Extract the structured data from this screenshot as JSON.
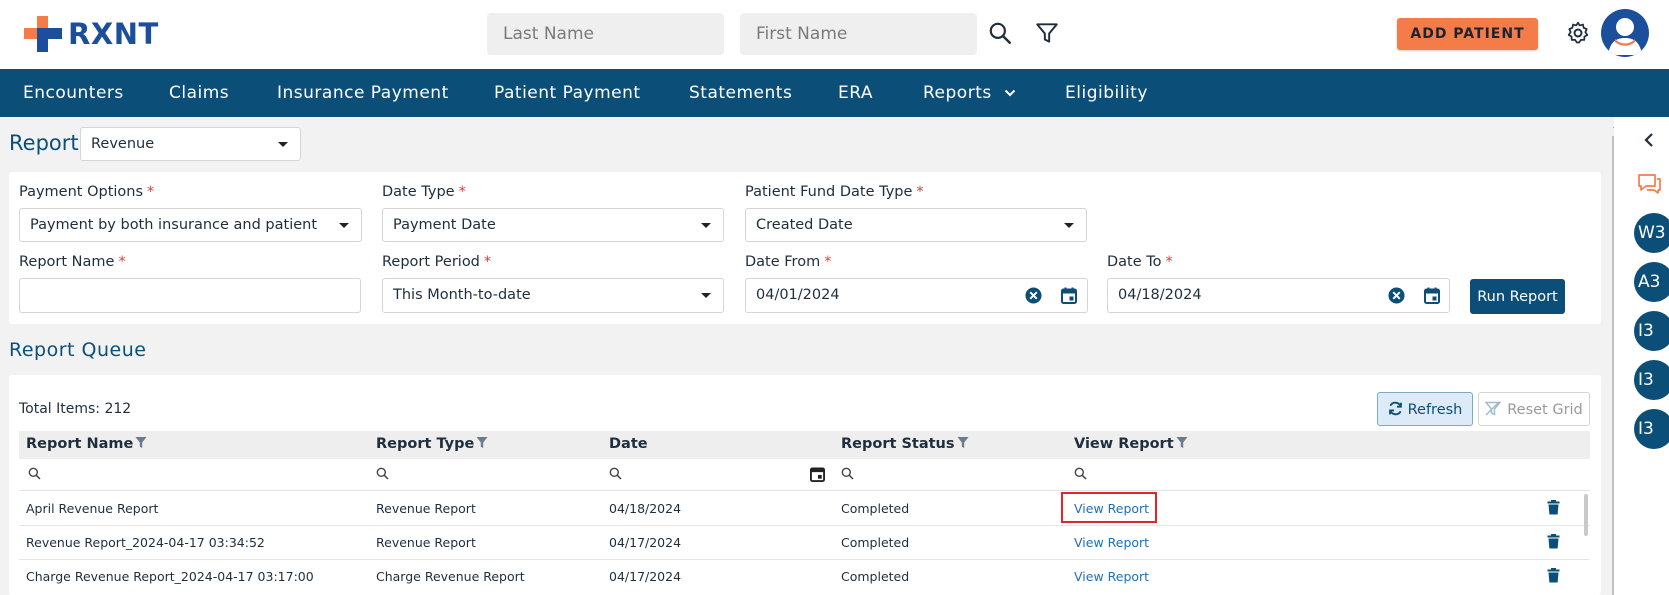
{
  "header": {
    "logo_text": "RXNT",
    "last_name_placeholder": "Last Name",
    "first_name_placeholder": "First Name",
    "add_patient_label": "ADD PATIENT"
  },
  "nav": {
    "items": [
      "Encounters",
      "Claims",
      "Insurance Payment",
      "Patient Payment",
      "Statements",
      "ERA",
      "Reports",
      "Eligibility"
    ]
  },
  "rail": {
    "badges": [
      "W3",
      "A3",
      "I3",
      "I3",
      "I3"
    ]
  },
  "report": {
    "title": "Report",
    "selected": "Revenue"
  },
  "filters": {
    "payment_options_label": "Payment Options",
    "payment_options_value": "Payment by both insurance and patient",
    "date_type_label": "Date Type",
    "date_type_value": "Payment Date",
    "fund_date_type_label": "Patient Fund Date Type",
    "fund_date_type_value": "Created Date",
    "report_name_label": "Report Name",
    "report_name_value": "",
    "report_period_label": "Report Period",
    "report_period_value": "This Month-to-date",
    "date_from_label": "Date From",
    "date_from_value": "04/01/2024",
    "date_to_label": "Date To",
    "date_to_value": "04/18/2024",
    "required_mark": "*",
    "run_report_label": "Run Report"
  },
  "queue": {
    "title": "Report Queue",
    "total_items": "Total Items: 212",
    "refresh_label": "Refresh",
    "reset_grid_label": "Reset Grid",
    "columns": [
      "Report Name",
      "Report Type",
      "Date",
      "Report Status",
      "View Report"
    ],
    "rows": [
      {
        "name": "April Revenue Report",
        "type": "Revenue Report",
        "date": "04/18/2024",
        "status": "Completed",
        "view": "View Report"
      },
      {
        "name": "Revenue Report_2024-04-17 03:34:52",
        "type": "Revenue Report",
        "date": "04/17/2024",
        "status": "Completed",
        "view": "View Report"
      },
      {
        "name": "Charge Revenue Report_2024-04-17 03:17:00",
        "type": "Charge Revenue Report",
        "date": "04/17/2024",
        "status": "Completed",
        "view": "View Report"
      }
    ]
  },
  "colors": {
    "brand_blue": "#0b4f79",
    "accent_orange": "#f47c48",
    "link_blue": "#1f6fb5",
    "highlight_red": "#e0262b"
  }
}
